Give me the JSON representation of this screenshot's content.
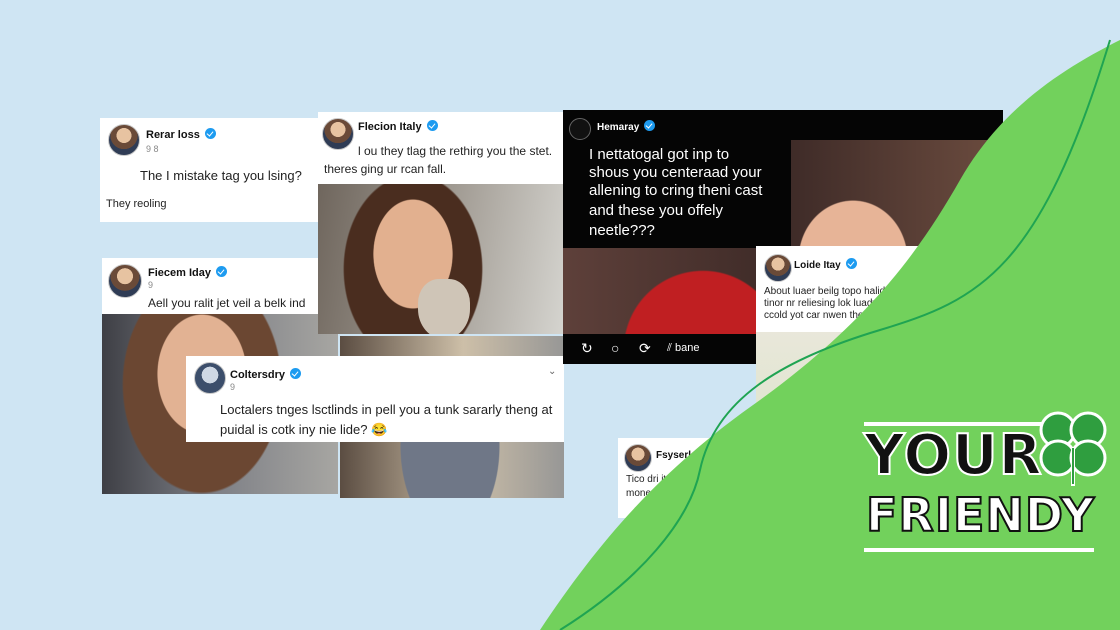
{
  "posts": [
    {
      "name": "Rerar loss",
      "handle": "9 8",
      "lines": [
        "The I mistake tag you lsing?",
        "They reoling"
      ]
    },
    {
      "name": "Flecion Italy",
      "lines": [
        "l ou they tlag the rethirg you the stet.",
        "theres ging ur rcan fall."
      ]
    },
    {
      "name": "Hemaray",
      "lines": [
        "I nettatogal got inp to",
        "shous you centeraad your",
        "allening to cring theni cast",
        "and these you offely",
        "neetle???"
      ],
      "actions": [
        "↻",
        "○",
        "⟳",
        "⫽ bane"
      ]
    },
    {
      "name": "Fiecem Iday",
      "handle": "9",
      "lines": [
        "Aell you ralit jet veil a belk ind"
      ]
    },
    {
      "name": "Coltersdry",
      "handle": "9",
      "lines": [
        "Loctalers tnges lsctlinds in pell you a tunk sararly theng at",
        "puidal is cotk iny nie lide? 😂"
      ]
    },
    {
      "name": "Loide Itay",
      "lines": [
        "About luaer beilg topo haliding tl",
        "tinor nr reliesing lok luadye-a",
        "ccold yot car nwen the datos."
      ]
    },
    {
      "name": "Fsyserlay",
      "lines": [
        "Tico dri it neih th",
        "mone a"
      ]
    }
  ],
  "logo": {
    "line1": "YOUR",
    "line2": "FRIENDY"
  },
  "colors": {
    "background": "#cfe5f3",
    "green": "#72d15c",
    "line": "#1fa452"
  }
}
